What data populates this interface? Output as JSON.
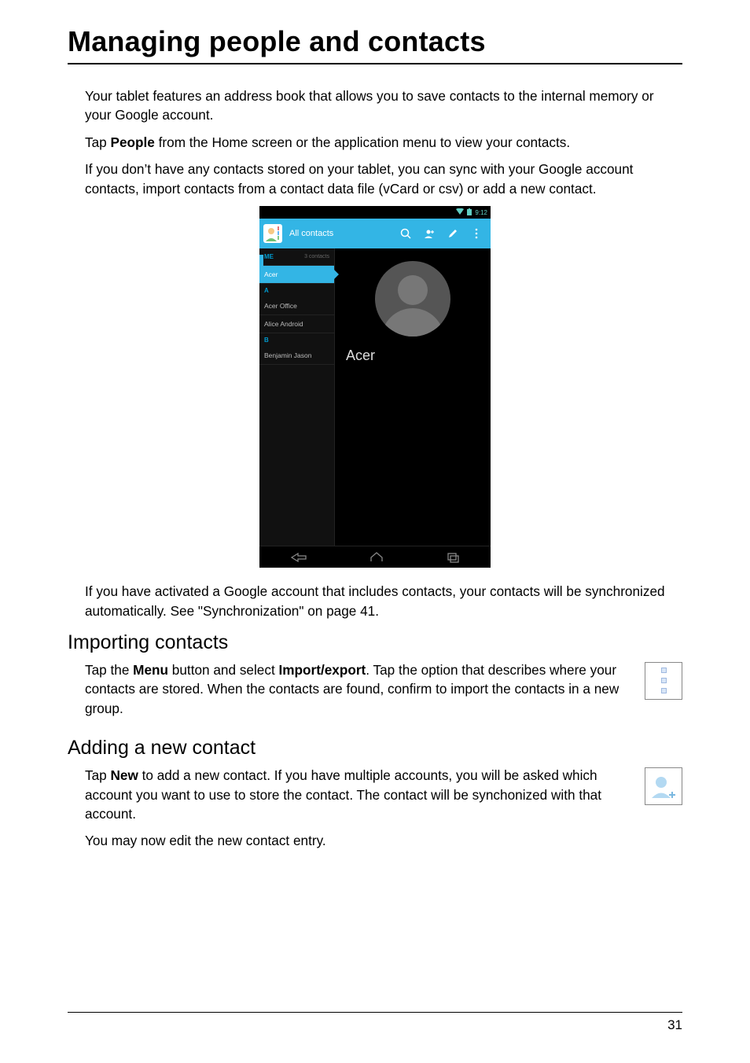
{
  "title": "Managing people and contacts",
  "body": {
    "p1": "Your tablet features an address book that allows you to save contacts to the internal memory or your Google account.",
    "p2_a": "Tap ",
    "p2_b": "People",
    "p2_c": " from the Home screen or the application menu to view your contacts.",
    "p3": "If you don’t have any contacts stored on your tablet, you can sync with your Google account contacts, import contacts from a contact data file (vCard or csv) or add a new contact.",
    "p4": "If you have activated a Google account that includes contacts, your contacts will be synchronized automatically. See \"Synchronization\" on page 41."
  },
  "s1": {
    "heading": "Importing contacts",
    "p_a": "Tap the ",
    "p_b": "Menu",
    "p_c": " button and select ",
    "p_d": "Import/export",
    "p_e": ". Tap the option that describes where your contacts are stored. When the contacts are found, confirm to import the contacts in a new group."
  },
  "s2": {
    "heading": "Adding a new contact",
    "p1_a": "Tap ",
    "p1_b": "New",
    "p1_c": " to add a new contact. If you have multiple accounts, you will be asked which account you want to use to store the contact. The contact will be synchonized with that account.",
    "p2": "You may now edit the new contact entry."
  },
  "tablet": {
    "status_time": "9:12",
    "header_title": "All contacts",
    "sidebar": {
      "me_label": "ME",
      "me_count": "3 contacts",
      "selected": "Acer",
      "letter_a": "A",
      "item_a1": "Acer Office",
      "item_a2": "Alice Android",
      "letter_b": "B",
      "item_b1": "Benjamin Jason"
    },
    "detail_name": "Acer"
  },
  "page_number": "31"
}
